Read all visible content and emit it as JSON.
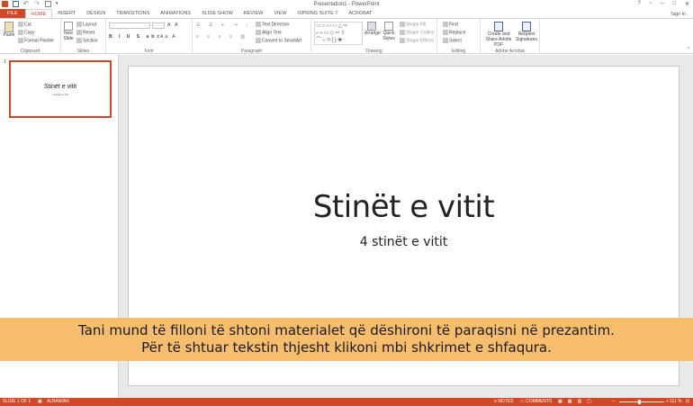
{
  "window": {
    "title": "Presentation1 - PowerPoint",
    "sign_in": "Sign in"
  },
  "qat": [
    "app-icon",
    "save-icon",
    "undo-icon",
    "redo-icon",
    "start-slideshow-icon",
    "customize-icon"
  ],
  "tabs": [
    "FILE",
    "HOME",
    "INSERT",
    "DESIGN",
    "TRANSITIONS",
    "ANIMATIONS",
    "SLIDE SHOW",
    "REVIEW",
    "VIEW",
    "ISPRING SUITE 7",
    "ACROBAT"
  ],
  "active_tab": "HOME",
  "ribbon": {
    "clipboard": {
      "label": "Clipboard",
      "paste": "Paste",
      "cut": "Cut",
      "copy": "Copy",
      "format_painter": "Format Painter"
    },
    "slides": {
      "label": "Slides",
      "new_slide": "New Slide",
      "layout": "Layout",
      "reset": "Reset",
      "section": "Section"
    },
    "font": {
      "label": "Font"
    },
    "paragraph": {
      "label": "Paragraph",
      "text_direction": "Text Direction",
      "align_text": "Align Text",
      "convert_smartart": "Convert to SmartArt"
    },
    "drawing": {
      "label": "Drawing",
      "arrange": "Arrange",
      "quick_styles": "Quick Styles",
      "shape_fill": "Shape Fill",
      "shape_outline": "Shape Outline",
      "shape_effects": "Shape Effects"
    },
    "editing": {
      "label": "Editing",
      "find": "Find",
      "replace": "Replace",
      "select": "Select"
    },
    "acrobat": {
      "label": "Adobe Acrobat",
      "create_share": "Create and Share Adobe PDF",
      "request_sig": "Request Signatures"
    }
  },
  "thumbnails": [
    {
      "number": "1",
      "title": "Stinët e vitit",
      "subtitle": "4 stinët e vitit"
    }
  ],
  "slide": {
    "title": "Stinët e vitit",
    "subtitle": "4 stinët e vitit"
  },
  "caption": {
    "line1": "Tani mund të filloni të shtoni materialet që dëshironi të paraqisni në prezantim.",
    "line2": "Për të shtuar tekstin thjesht klikoni mbi shkrimet e shfaqura."
  },
  "status": {
    "slide_of": "SLIDE 1 OF 1",
    "language": "ALBANIAN",
    "notes": "NOTES",
    "comments": "COMMENTS",
    "zoom": "111 %"
  },
  "colors": {
    "accent": "#d24726",
    "caption_bg": "#f6bd6c"
  }
}
